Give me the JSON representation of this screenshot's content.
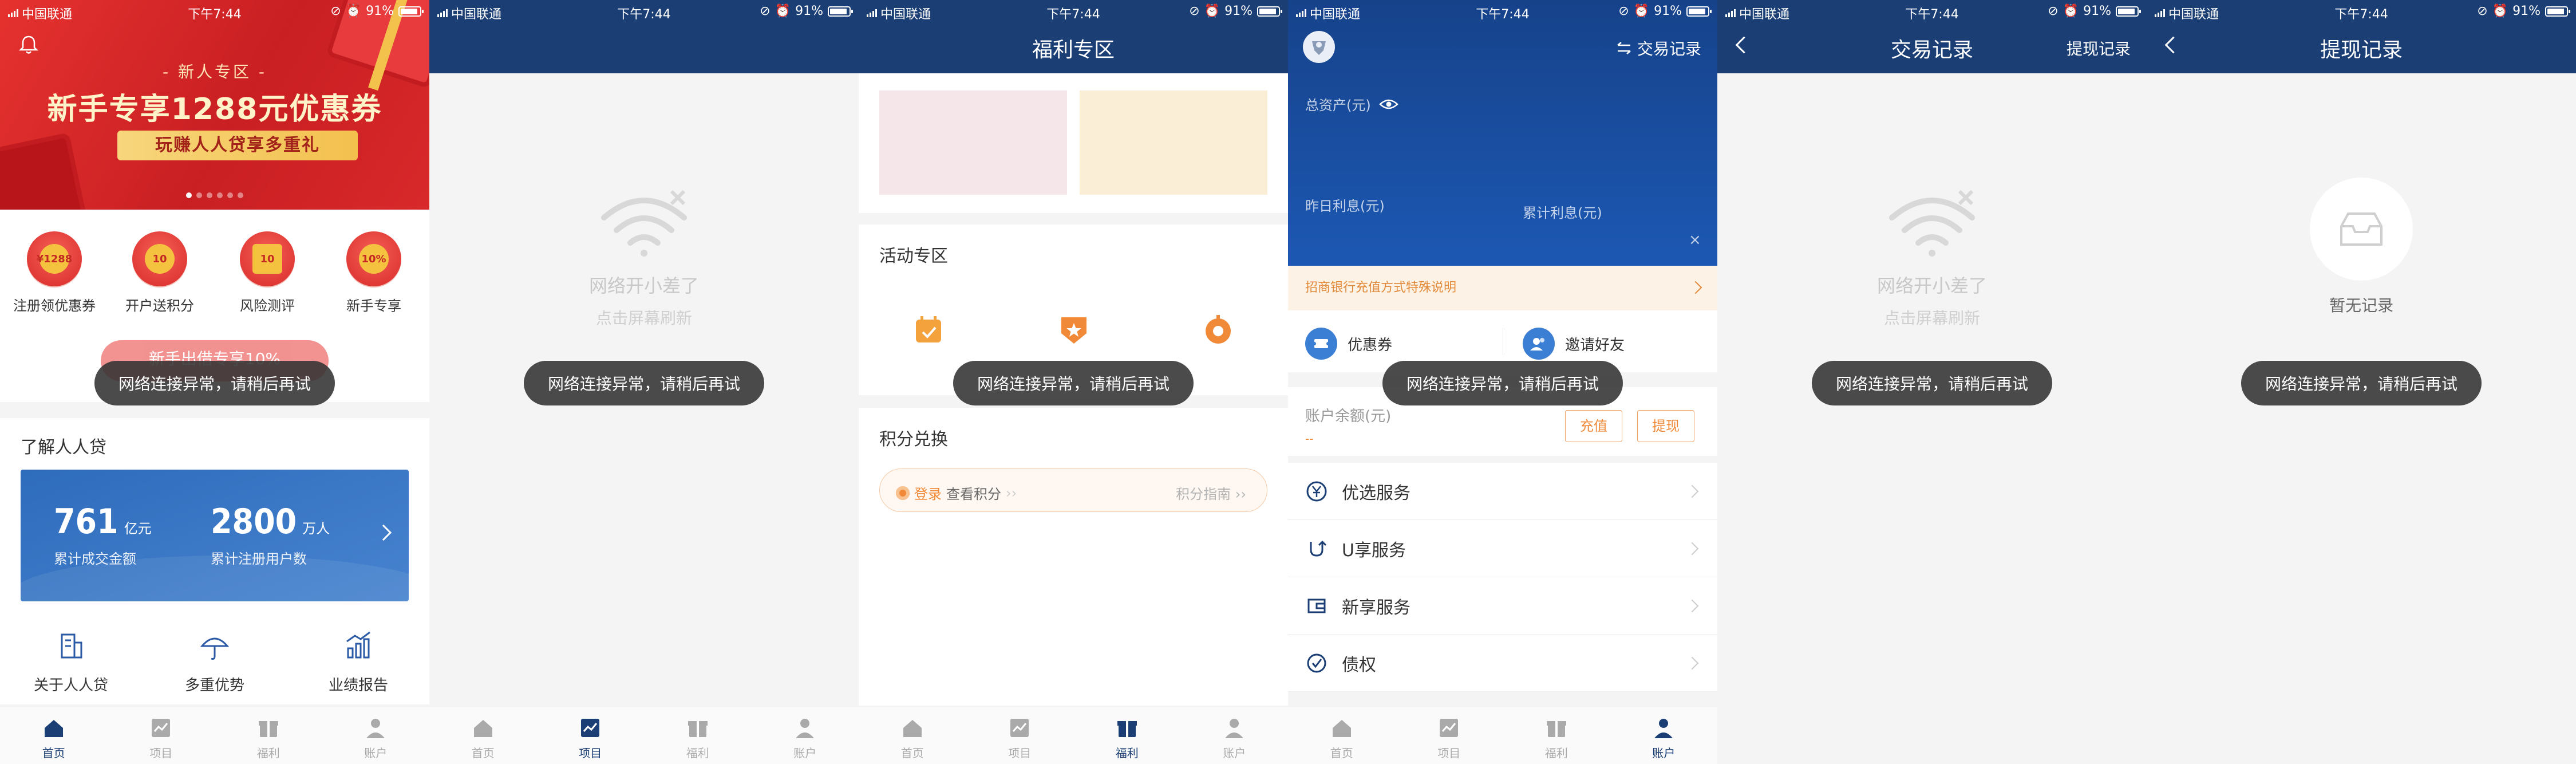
{
  "status_bar": {
    "carrier": "中国联通",
    "time": "下午7:44",
    "battery": "91%",
    "battery_level": 0.91
  },
  "tabbar": {
    "items": [
      "首页",
      "项目",
      "福利",
      "账户"
    ]
  },
  "toast": "网络连接异常，请稍后再试",
  "empty_network": {
    "title": "网络开小差了",
    "hint": "点击屏幕刷新"
  },
  "home": {
    "banner": {
      "sub": "- 新人专区 -",
      "headline": "新手专享1288元优惠券",
      "pill": "玩赚人人贷享多重礼",
      "slide_count": 6,
      "active_slide": 1
    },
    "quick": [
      {
        "badge": "¥1288",
        "label": "注册领优惠券"
      },
      {
        "badge": "10",
        "label": "开户送积分"
      },
      {
        "badge": "10",
        "label": "风险测评"
      },
      {
        "badge": "10%",
        "label": "新手专享"
      }
    ],
    "newbie_button": "新手出借专享10%",
    "know_title": "了解人人贷",
    "stats": [
      {
        "num": "761",
        "unit": "亿元",
        "label": "累计成交金额"
      },
      {
        "num": "2800",
        "unit": "万人",
        "label": "累计注册用户数"
      }
    ],
    "about": [
      "关于人人贷",
      "多重优势",
      "业绩报告"
    ]
  },
  "welfare": {
    "title": "福利专区",
    "activity_title": "活动专区",
    "points_title": "积分兑换",
    "points_login": "登录",
    "points_view": "查看积分",
    "points_guide": "积分指南",
    "colors": {
      "promo_left": "#f5e6ea",
      "promo_right": "#faefd6",
      "accent": "#f08a38"
    }
  },
  "account": {
    "nav_right": "交易记录",
    "total_assets_label": "总资产(元)",
    "yesterday_label": "昨日利息(元)",
    "cumulative_label": "累计利息(元)",
    "notice": "招商银行充值方式特殊说明",
    "coupon": "优惠券",
    "invite": "邀请好友",
    "balance_label": "账户余额(元)",
    "balance_value": "--",
    "recharge": "充值",
    "withdraw": "提现",
    "menu": [
      "优选服务",
      "U享服务",
      "新享服务",
      "债权"
    ]
  },
  "trade_records": {
    "title": "交易记录",
    "nav_right": "提现记录"
  },
  "withdraw_records": {
    "title": "提现记录",
    "empty": "暂无记录"
  }
}
